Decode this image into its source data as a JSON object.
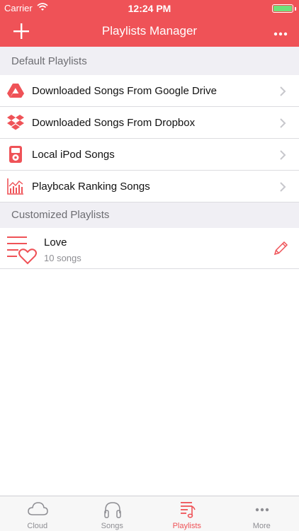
{
  "status_bar": {
    "carrier": "Carrier",
    "time": "12:24 PM"
  },
  "nav": {
    "title": "Playlists Manager",
    "add_icon": "plus-icon",
    "more_icon": "ellipsis-icon"
  },
  "colors": {
    "accent": "#ef5257",
    "battery": "#6fe07a",
    "section_bg": "#f0eff4"
  },
  "sections": {
    "default": {
      "title": "Default Playlists"
    },
    "customized": {
      "title": "Customized Playlists"
    }
  },
  "default_playlists": [
    {
      "label": "Downloaded Songs From Google Drive",
      "icon": "google-drive-icon"
    },
    {
      "label": "Downloaded Songs From Dropbox",
      "icon": "dropbox-icon"
    },
    {
      "label": "Local iPod Songs",
      "icon": "ipod-icon"
    },
    {
      "label": "Playbcak Ranking Songs",
      "icon": "ranking-chart-icon"
    }
  ],
  "custom_playlists": [
    {
      "name": "Love",
      "count": "10 songs",
      "icon": "heart-playlist-icon",
      "edit_icon": "pencil-icon"
    }
  ],
  "tabs": [
    {
      "label": "Cloud",
      "icon": "cloud-icon",
      "active": false
    },
    {
      "label": "Songs",
      "icon": "headphones-icon",
      "active": false
    },
    {
      "label": "Playlists",
      "icon": "playlist-icon",
      "active": true
    },
    {
      "label": "More",
      "icon": "more-icon",
      "active": false
    }
  ]
}
